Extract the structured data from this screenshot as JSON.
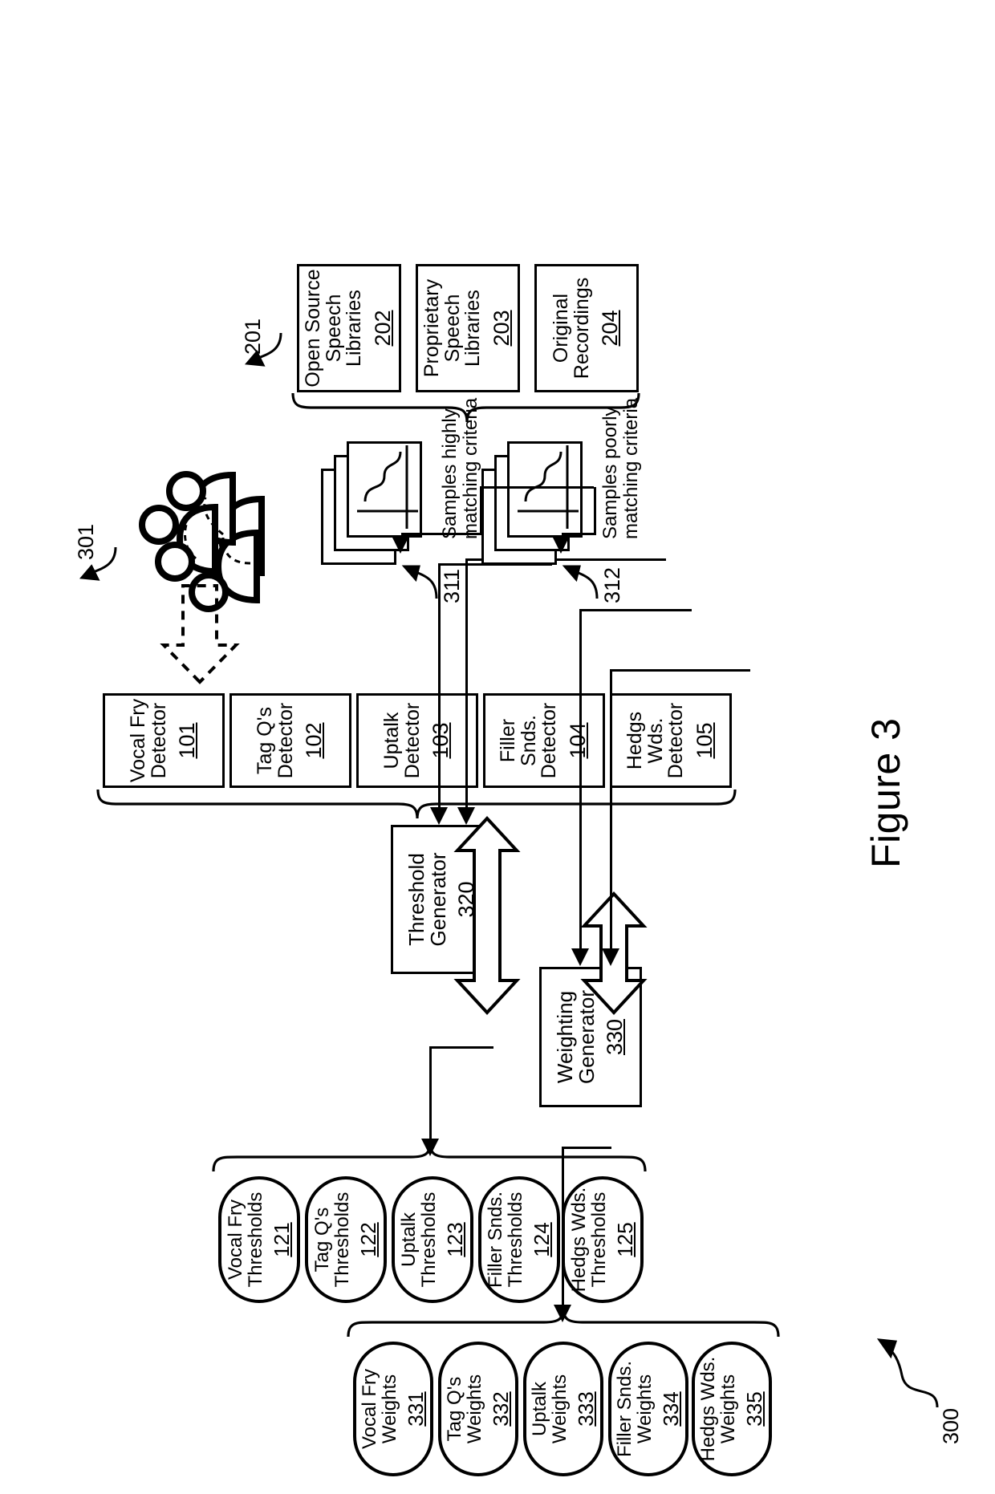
{
  "figure": {
    "title": "Figure 3",
    "system_ref": "300"
  },
  "weights": {
    "items": [
      {
        "label": "Vocal Fry\nWeights",
        "num": "331"
      },
      {
        "label": "Tag Q's\nWeights",
        "num": "332"
      },
      {
        "label": "Uptalk\nWeights",
        "num": "333"
      },
      {
        "label": "Filler Snds.\nWeights",
        "num": "334"
      },
      {
        "label": "Hedgs Wds.\nWeights",
        "num": "335"
      }
    ]
  },
  "thresholds": {
    "items": [
      {
        "label": "Vocal Fry\nThresholds",
        "num": "121"
      },
      {
        "label": "Tag Q's\nThresholds",
        "num": "122"
      },
      {
        "label": "Uptalk\nThresholds",
        "num": "123"
      },
      {
        "label": "Filler Snds.\nThresholds",
        "num": "124"
      },
      {
        "label": "Hedgs Wds.\nThresholds",
        "num": "125"
      }
    ]
  },
  "detectors": {
    "items": [
      {
        "label": "Vocal Fry\nDetector",
        "num": "101"
      },
      {
        "label": "Tag Q's\nDetector",
        "num": "102"
      },
      {
        "label": "Uptalk\nDetector",
        "num": "103"
      },
      {
        "label": "Filler Snds.\nDetector",
        "num": "104"
      },
      {
        "label": "Hedgs Wds.\nDetector",
        "num": "105"
      }
    ]
  },
  "generators": {
    "threshold": {
      "label": "Threshold\nGenerator",
      "num": "320"
    },
    "weighting": {
      "label": "Weighting\nGenerator",
      "num": "330"
    }
  },
  "samples": {
    "high": {
      "caption": "Samples highly\nmatching criteria",
      "num": "311"
    },
    "poor": {
      "caption": "Samples poorly\nmatching criteria",
      "num": "312"
    }
  },
  "sources": {
    "group_ref": "201",
    "items": [
      {
        "label": "Open Source\nSpeech Libraries",
        "num": "202"
      },
      {
        "label": "Proprietary\nSpeech Libraries",
        "num": "203"
      },
      {
        "label": "Original\nRecordings",
        "num": "204"
      }
    ]
  },
  "speakers": {
    "ref": "301"
  }
}
